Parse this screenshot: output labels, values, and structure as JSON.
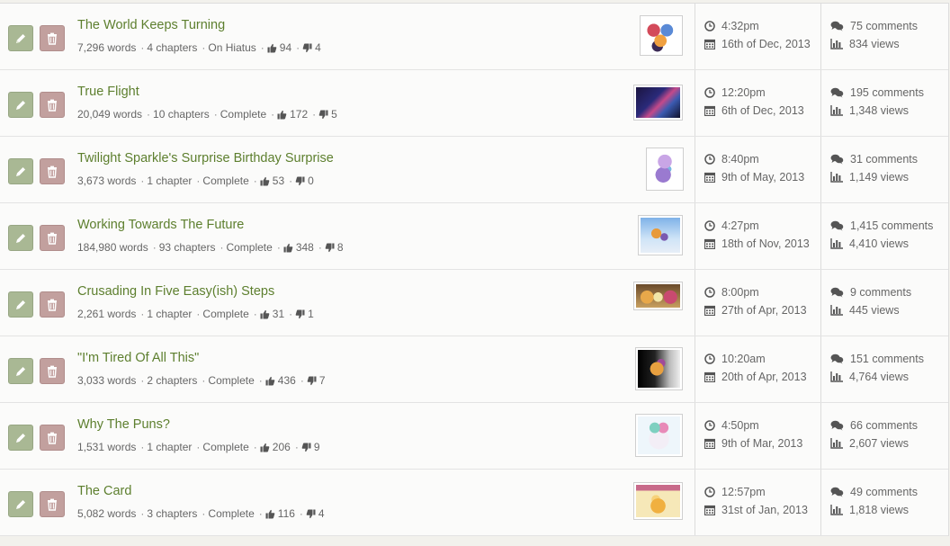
{
  "stories": [
    {
      "title": "The World Keeps Turning",
      "words": "7,296 words",
      "chapters": "4 chapters",
      "status": "On Hiatus",
      "likes": "94",
      "dislikes": "4",
      "time": "4:32pm",
      "date": "16th of Dec, 2013",
      "comments": "75 comments",
      "views": "834 views"
    },
    {
      "title": "True Flight",
      "words": "20,049 words",
      "chapters": "10 chapters",
      "status": "Complete",
      "likes": "172",
      "dislikes": "5",
      "time": "12:20pm",
      "date": "6th of Dec, 2013",
      "comments": "195 comments",
      "views": "1,348 views"
    },
    {
      "title": "Twilight Sparkle's Surprise Birthday Surprise",
      "words": "3,673 words",
      "chapters": "1 chapter",
      "status": "Complete",
      "likes": "53",
      "dislikes": "0",
      "time": "8:40pm",
      "date": "9th of May, 2013",
      "comments": "31 comments",
      "views": "1,149 views"
    },
    {
      "title": "Working Towards The Future",
      "words": "184,980 words",
      "chapters": "93 chapters",
      "status": "Complete",
      "likes": "348",
      "dislikes": "8",
      "time": "4:27pm",
      "date": "18th of Nov, 2013",
      "comments": "1,415 comments",
      "views": "4,410 views"
    },
    {
      "title": "Crusading In Five Easy(ish) Steps",
      "words": "2,261 words",
      "chapters": "1 chapter",
      "status": "Complete",
      "likes": "31",
      "dislikes": "1",
      "time": "8:00pm",
      "date": "27th of Apr, 2013",
      "comments": "9 comments",
      "views": "445 views"
    },
    {
      "title": "\"I'm Tired Of All This\"",
      "words": "3,033 words",
      "chapters": "2 chapters",
      "status": "Complete",
      "likes": "436",
      "dislikes": "7",
      "time": "10:20am",
      "date": "20th of Apr, 2013",
      "comments": "151 comments",
      "views": "4,764 views"
    },
    {
      "title": "Why The Puns?",
      "words": "1,531 words",
      "chapters": "1 chapter",
      "status": "Complete",
      "likes": "206",
      "dislikes": "9",
      "time": "4:50pm",
      "date": "9th of Mar, 2013",
      "comments": "66 comments",
      "views": "2,607 views"
    },
    {
      "title": "The Card",
      "words": "5,082 words",
      "chapters": "3 chapters",
      "status": "Complete",
      "likes": "116",
      "dislikes": "4",
      "time": "12:57pm",
      "date": "31st of Jan, 2013",
      "comments": "49 comments",
      "views": "1,818 views"
    }
  ],
  "icons": {
    "edit": "pencil-icon",
    "delete": "trash-icon",
    "like": "thumbs-up-icon",
    "dislike": "thumbs-down-icon",
    "time": "clock-icon",
    "date": "calendar-icon",
    "comments": "comments-icon",
    "views": "bar-chart-icon"
  },
  "colors": {
    "title": "#5d7f2e",
    "edit_button": "#a9b894",
    "delete_button": "#c2a09e"
  }
}
